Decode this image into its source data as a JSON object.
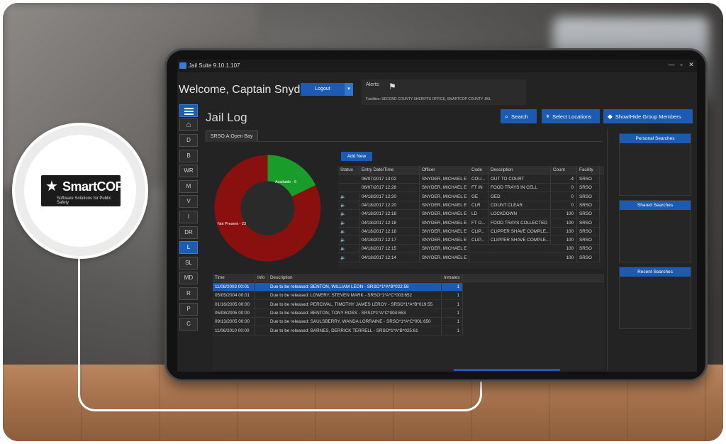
{
  "branding": {
    "logo_text": "SmartCOP",
    "logo_tagline": "Software Solutions for Public Safety"
  },
  "window": {
    "title": "Jail Suite 9.10.1.107",
    "controls": [
      "—",
      "▫",
      "✕"
    ]
  },
  "header": {
    "welcome": "Welcome, Captain Snyder",
    "logout_label": "Logout",
    "alerts_label": "Alerts:",
    "facilities_text": "Facilities: SECOND COUNTY SHERIFFS OFFICE, SMARTCOP COUNTY JAIL"
  },
  "nav": {
    "items": [
      "D",
      "B",
      "WR",
      "M",
      "V",
      "I",
      "DR",
      "L",
      "SL",
      "MD",
      "R",
      "P",
      "C"
    ],
    "active": "L"
  },
  "page": {
    "title": "Jail Log",
    "tab": "SRSO:A:Open Bay",
    "add_new_label": "Add New"
  },
  "toolbar": {
    "search_label": "Search",
    "select_locations_label": "Select Locations",
    "group_members_label": "Show/Hide Group Members"
  },
  "donut": {
    "available_label": "Available - 5",
    "not_present_label": "Not Present - 23",
    "available_count": 5,
    "not_present_count": 23,
    "available_color": "#1a9c2a",
    "not_present_color": "#b01515"
  },
  "log_table": {
    "columns": [
      "Status",
      "Entry Date/Time",
      "Officer",
      "Code",
      "Description",
      "Count",
      "Facility"
    ],
    "rows": [
      [
        "",
        "06/07/2017 13:02",
        "SNYDER, MICHAEL E",
        "COU...",
        "OUT TO COURT",
        "-4",
        "SRSO"
      ],
      [
        "",
        "06/07/2017 12:28",
        "SNYDER, MICHAEL E",
        "FT IN",
        "FOOD TRAYS IN CELL",
        "0",
        "SRSO"
      ],
      [
        "speaker",
        "04/18/2017 12:20",
        "SNYDER, MICHAEL E",
        "GE",
        "GED",
        "0",
        "SRSO"
      ],
      [
        "speaker",
        "04/18/2017 12:20",
        "SNYDER, MICHAEL E",
        "CLR",
        "COUNT CLEAR",
        "0",
        "SRSO"
      ],
      [
        "speaker",
        "04/18/2017 12:18",
        "SNYDER, MICHAEL E",
        "LD",
        "LOCKDOWN",
        "100",
        "SRSO"
      ],
      [
        "speaker",
        "04/18/2017 12:18",
        "SNYDER, MICHAEL E",
        "FT O...",
        "FOOD TRAYS COLLECTED",
        "100",
        "SRSO"
      ],
      [
        "speaker",
        "04/18/2017 12:18",
        "SNYDER, MICHAEL E",
        "CLIP...",
        "CLIPPER SHAVE COMPLE...",
        "100",
        "SRSO"
      ],
      [
        "speaker",
        "04/18/2017 12:17",
        "SNYDER, MICHAEL E",
        "CLIP...",
        "CLIPPER SHAVE COMPLE...",
        "100",
        "SRSO"
      ],
      [
        "speaker",
        "04/18/2017 12:15",
        "SNYDER, MICHAEL E",
        "",
        "",
        "100",
        "SRSO"
      ],
      [
        "speaker",
        "04/18/2017 12:14",
        "SNYDER, MICHAEL E",
        "",
        "",
        "100",
        "SRSO"
      ]
    ]
  },
  "release_table": {
    "columns": [
      "Time",
      "Info",
      "Description",
      "Inmates"
    ],
    "rows": [
      [
        "11/08/2003 00:01",
        "",
        "Due to be released: BENTON, WILLIAM LEON - SRSO*1*A*B*022:58",
        "1"
      ],
      [
        "05/05/2004 00:01",
        "",
        "Due to be released: LOWERY, STEVEN MARK - SRSO*1*A*C*003:652",
        "1"
      ],
      [
        "01/16/2005 00:00",
        "",
        "Due to be released: PERCIVAL, TIMOTHY JAMES LEROY - SRSO*1*A*B*019:55",
        "1"
      ],
      [
        "05/08/2005 00:00",
        "",
        "Due to be released: BENTON, TONY ROSS - SRSO*1*A*C*004:653",
        "1"
      ],
      [
        "09/13/2005 00:00",
        "",
        "Due to be released: SAULSBERRY, WANDA LORRAINE - SRSO*1*A*C*001:650",
        "1"
      ],
      [
        "11/06/2010 00:00",
        "",
        "Due to be released: BARNES, DERRICK TERRELL - SRSO*1*A*B*025:61",
        "1"
      ]
    ],
    "selected_row": 0
  },
  "side_panels": {
    "personal": "Personal Searches",
    "shared": "Shared Searches",
    "recent": "Recent Searches"
  }
}
